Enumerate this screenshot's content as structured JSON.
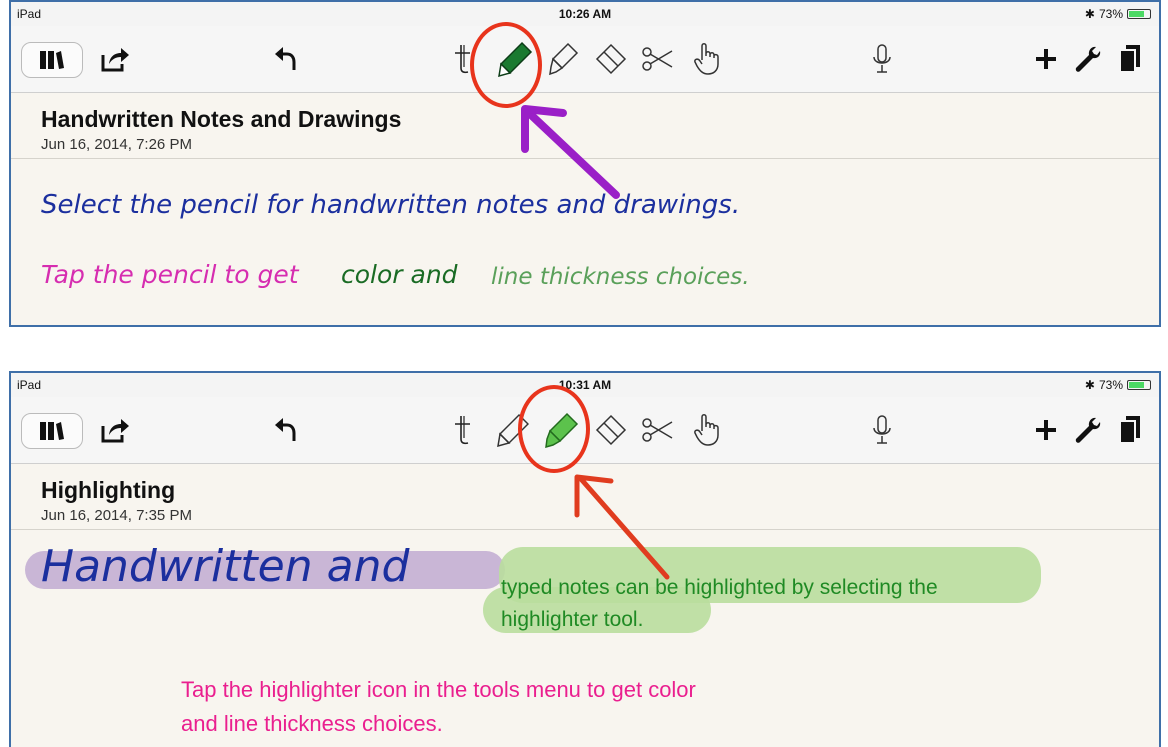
{
  "status": {
    "carrier": "iPad",
    "battery": "73%",
    "time1": "10:26 AM",
    "time2": "10:31 AM"
  },
  "colors": {
    "frame": "#3f6fa8",
    "paper": "#f8f5ef",
    "pencil_green": "#1a7a30",
    "circle_red": "#e8341c",
    "arrow_purple": "#9a1fc7",
    "ink_blue": "#1b2f9e",
    "ink_pink": "#d62db0",
    "highlight_purple": "#c9b6d6",
    "highlight_green": "#b9de9d",
    "typed_green": "#1f8a24",
    "typed_pink": "#ea1f8f"
  },
  "toolbar_icons": [
    "library-icon",
    "share-icon",
    "undo-icon",
    "text-tool-icon",
    "pencil-icon",
    "highlighter-icon",
    "eraser-icon",
    "scissors-icon",
    "hand-icon",
    "microphone-icon",
    "plus-icon",
    "wrench-icon",
    "pages-icon"
  ],
  "note1": {
    "title": "Handwritten Notes and Drawings",
    "date": "Jun 16, 2014, 7:26 PM",
    "line1": "Select the pencil for handwritten notes and drawings.",
    "line2_a": "Tap the pencil to get",
    "line2_b": "color and",
    "line2_c": "line thickness choices."
  },
  "note2": {
    "title": "Highlighting",
    "date": "Jun 16, 2014, 7:35 PM",
    "handwritten": "Handwritten and",
    "typed_line1": "typed notes can be highlighted by selecting the",
    "typed_line2": "highlighter tool.",
    "pink_line1": "Tap the highlighter icon in the tools menu to get color",
    "pink_line2": "and line thickness choices."
  }
}
